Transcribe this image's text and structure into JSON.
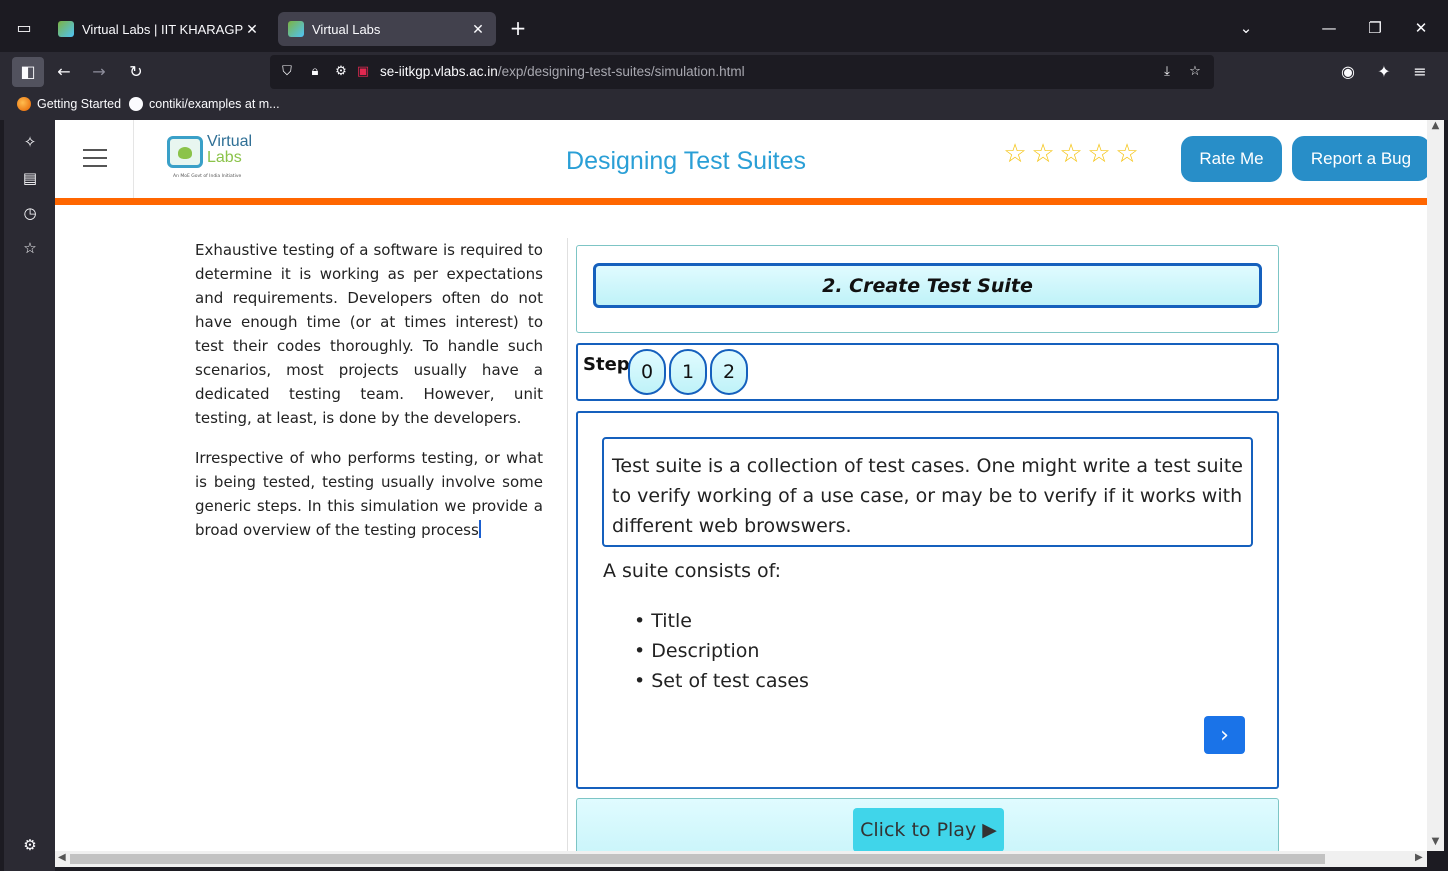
{
  "browser": {
    "tabs": [
      {
        "title": "Virtual Labs | IIT KHARAGPUR",
        "active": false
      },
      {
        "title": "Virtual Labs",
        "active": true
      }
    ],
    "url_host": "se-iitkgp.vlabs.ac.in",
    "url_path": "/exp/designing-test-suites/simulation.html",
    "bookmarks": [
      {
        "label": "Getting Started",
        "icon": "firefox-icon"
      },
      {
        "label": "contiki/examples at m...",
        "icon": "github-icon"
      }
    ]
  },
  "site": {
    "logo_line1": "Virtual",
    "logo_line2": "Labs",
    "logo_tagline": "An MoE Govt of India Initiative",
    "title": "Designing Test Suites",
    "rating_stars": 5,
    "rate_label": "Rate Me",
    "bug_label": "Report a Bug",
    "accent_color": "#288ec8",
    "bar_color": "#ff6600"
  },
  "intro": {
    "para1": "Exhaustive testing of a software is required to determine it is working as per expectations and requirements. Developers often do not have enough time (or at times interest) to test their codes thoroughly. To handle such scenarios, most projects usually have a dedicated testing team. However, unit testing, at least, is done by the developers.",
    "para2": "Irrespective of who performs testing, or what is being tested, testing usually involve some generic steps. In this simulation we provide a broad overview of the testing process"
  },
  "simulation": {
    "section_title": "2. Create Test Suite",
    "step_label": "Step",
    "steps": [
      "0",
      "1",
      "2"
    ],
    "definition": "Test suite is a collection of test cases. One might write a test suite to verify working of a use case, or may be to verify if it works with different web browswers.",
    "suite_label": "A suite consists of:",
    "suite_items": [
      "Title",
      "Description",
      "Set of test cases"
    ],
    "play_label": "Click to Play ▶"
  }
}
